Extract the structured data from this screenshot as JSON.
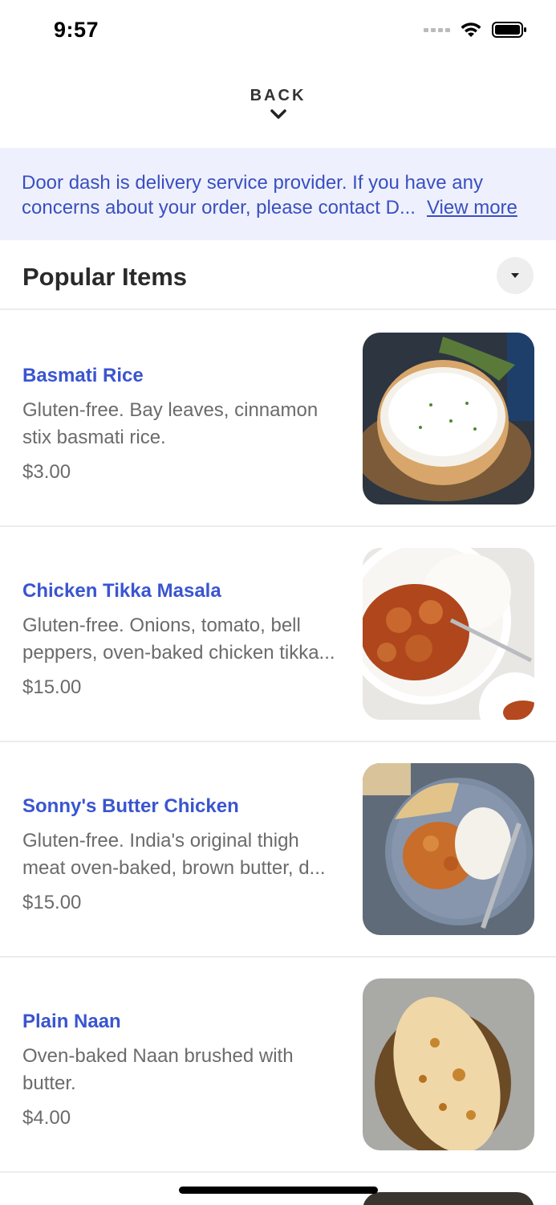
{
  "status_bar": {
    "time": "9:57"
  },
  "header": {
    "back_label": "BACK"
  },
  "notice": {
    "line1": "Door dash is delivery service provider. If you have any",
    "line2": "concerns about your order, please contact D...",
    "view_more": "View more"
  },
  "section": {
    "title": "Popular Items"
  },
  "items": [
    {
      "name": "Basmati Rice",
      "desc1": "Gluten-free. Bay leaves, cinnamon",
      "desc2": "stix basmati rice.",
      "price": "$3.00"
    },
    {
      "name": "Chicken Tikka Masala",
      "desc1": "Gluten-free. Onions, tomato, bell",
      "desc2": "peppers, oven-baked chicken tikka...",
      "price": "$15.00"
    },
    {
      "name": "Sonny's Butter Chicken",
      "desc1": "Gluten-free. India's original thigh",
      "desc2": "meat oven-baked, brown butter, d...",
      "price": "$15.00"
    },
    {
      "name": "Plain Naan",
      "desc1": "Oven-baked Naan brushed with",
      "desc2": "butter.",
      "price": "$4.00"
    }
  ],
  "icons": {
    "back": "chevron-down-icon",
    "collapse": "triangle-down-icon",
    "wifi": "wifi-icon",
    "battery": "battery-icon",
    "signal": "signal-icon"
  },
  "colors": {
    "accent": "#3a55d0",
    "notice_bg": "#eef1fd",
    "notice_text": "#3a4fc1"
  }
}
